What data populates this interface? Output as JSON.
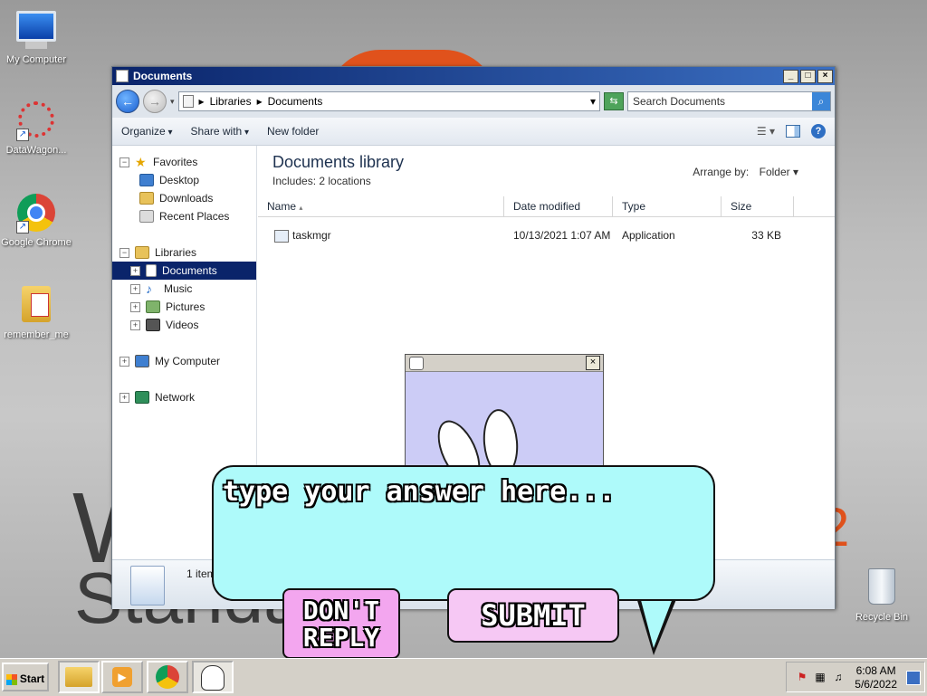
{
  "desktop": {
    "icons": [
      {
        "label": "My Computer"
      },
      {
        "label": "DataWagon..."
      },
      {
        "label": "Google Chrome"
      },
      {
        "label": "remember_me"
      },
      {
        "label": "Recycle Bin"
      }
    ]
  },
  "window": {
    "title": "Documents",
    "breadcrumb": [
      "Libraries",
      "Documents"
    ],
    "search_placeholder": "Search Documents",
    "toolbar": {
      "organize": "Organize",
      "share_with": "Share with",
      "new_folder": "New folder"
    },
    "nav": {
      "favorites": "Favorites",
      "desktop": "Desktop",
      "downloads": "Downloads",
      "recent_places": "Recent Places",
      "libraries": "Libraries",
      "documents": "Documents",
      "music": "Music",
      "pictures": "Pictures",
      "videos": "Videos",
      "my_computer": "My Computer",
      "network": "Network"
    },
    "library_title": "Documents library",
    "includes": "Includes:",
    "locations": "2 locations",
    "arrange_by": "Arrange by:",
    "arrange_value": "Folder",
    "columns": {
      "name": "Name",
      "date_modified": "Date modified",
      "type": "Type",
      "size": "Size"
    },
    "files": [
      {
        "name": "taskmgr",
        "date_modified": "10/13/2021 1:07 AM",
        "type": "Application",
        "size": "33 KB"
      }
    ],
    "status": "1 item"
  },
  "popup": {
    "answer_placeholder": "type your answer here...",
    "dont_reply": "DON'T REPLY",
    "submit": "SUBMIT"
  },
  "taskbar": {
    "start_label": "Start",
    "time": "6:08 AM",
    "date": "5/6/2022"
  },
  "colors": {
    "bubble": "#aefafa",
    "dont_reply_button": "#f3a6ef",
    "submit_button": "#f6c8f4",
    "popup_bg": "#ccccf6",
    "selection": "#0a246a",
    "title_bar": "#0a246a"
  }
}
